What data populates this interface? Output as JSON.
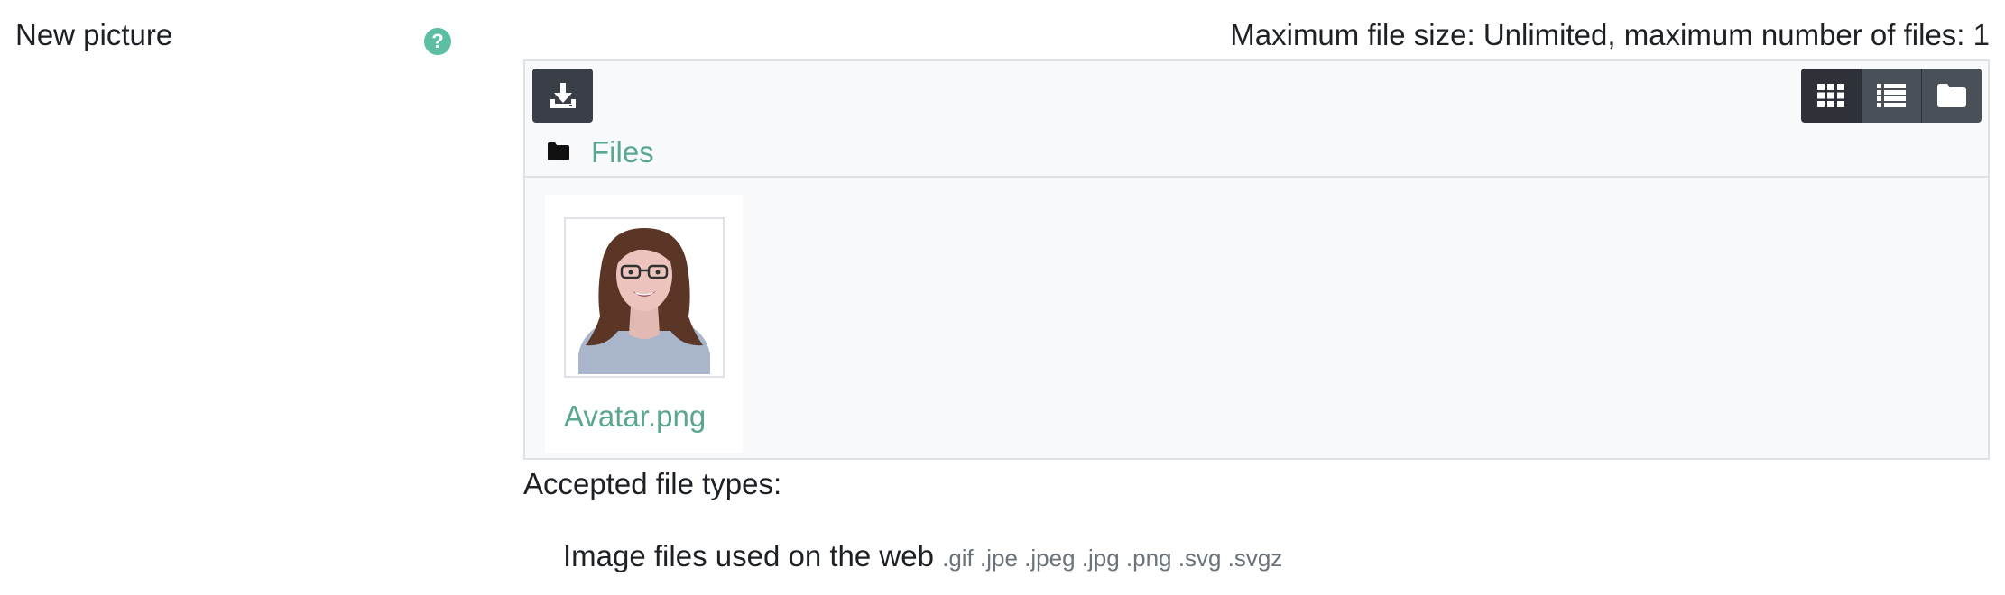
{
  "field": {
    "label": "New picture",
    "help_icon": "question-circle-icon",
    "max_info": "Maximum file size: Unlimited, maximum number of files: 1"
  },
  "filemanager": {
    "add_icon": "download-icon",
    "views": [
      {
        "name": "icon-view",
        "icon": "grid-icon",
        "active": true
      },
      {
        "name": "list-view",
        "icon": "list-icon",
        "active": false
      },
      {
        "name": "tree-view",
        "icon": "folder-icon",
        "active": false
      }
    ],
    "path": {
      "icon": "folder-icon",
      "label": "Files"
    },
    "files": [
      {
        "name": "Avatar.png",
        "icon": "avatar-thumbnail"
      }
    ]
  },
  "accepted": {
    "label": "Accepted file types:",
    "types": [
      {
        "name": "Image files used on the web",
        "extensions": ".gif .jpe .jpeg .jpg .png .svg .svgz"
      }
    ]
  },
  "colors": {
    "link": "#5aa68f",
    "help": "#5cbfa3",
    "button_dark": "#3a3f47"
  }
}
